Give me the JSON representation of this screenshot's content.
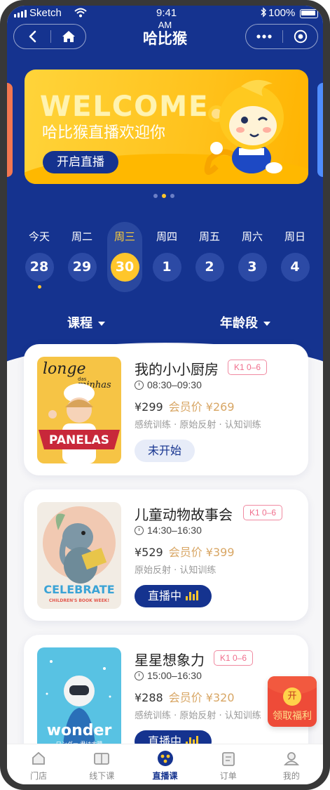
{
  "status_bar": {
    "carrier": "Sketch",
    "time": "9:41",
    "time_suffix": "AM",
    "battery": "100%"
  },
  "nav": {
    "title": "哈比猴",
    "back_icon": "chevron-left-icon",
    "home_icon": "home-icon",
    "more_icon": "more-dots-icon",
    "close_icon": "target-circle-icon"
  },
  "banner": {
    "headline": "WELCOME",
    "subtitle": "哈比猴直播欢迎你",
    "cta": "开启直播",
    "mascot": "monkey-mascot"
  },
  "carousel": {
    "total": 3,
    "active": 2
  },
  "week": [
    {
      "label": "今天",
      "date": "28",
      "selected": false,
      "has_event": true
    },
    {
      "label": "周二",
      "date": "29",
      "selected": false,
      "has_event": false
    },
    {
      "label": "周三",
      "date": "30",
      "selected": true,
      "has_event": false
    },
    {
      "label": "周四",
      "date": "1",
      "selected": false,
      "has_event": false
    },
    {
      "label": "周五",
      "date": "2",
      "selected": false,
      "has_event": false
    },
    {
      "label": "周六",
      "date": "3",
      "selected": false,
      "has_event": false
    },
    {
      "label": "周日",
      "date": "4",
      "selected": false,
      "has_event": false
    }
  ],
  "filters": {
    "course": "课程",
    "age": "年龄段"
  },
  "courses": [
    {
      "name": "我的小小厨房",
      "tag": "K1 0–6",
      "time": "08:30–09:30",
      "price": "¥299",
      "member_price": "会员价 ¥269",
      "skills": "感统训练 · 原始反射 · 认知训练",
      "button": "未开始",
      "live": false,
      "poster": {
        "text1": "longe",
        "text2": "das",
        "text3": "minhas",
        "text4": "PANELAS"
      }
    },
    {
      "name": "儿童动物故事会",
      "tag": "K1 0–6",
      "time": "14:30–16:30",
      "price": "¥529",
      "member_price": "会员价 ¥399",
      "skills": "原始反射 · 认知训练",
      "button": "直播中",
      "live": true,
      "poster": {
        "text1": "CELEBRATE",
        "text2": "CHILDREN'S BOOK WEEK!"
      }
    },
    {
      "name": "星星想象力",
      "tag": "K1 0–6",
      "time": "15:00–16:30",
      "price": "¥288",
      "member_price": "会员价 ¥320",
      "skills": "感统训练 · 原始反射 · 认知训练",
      "button": "直播中",
      "live": true,
      "poster": {
        "text1": "wonder",
        "text2": "ワンダー 君は太陽"
      }
    }
  ],
  "red_packet": {
    "coin": "开",
    "label": "领取福利"
  },
  "tabs": [
    {
      "label": "门店",
      "icon": "store-icon",
      "active": false
    },
    {
      "label": "线下课",
      "icon": "book-icon",
      "active": false
    },
    {
      "label": "直播课",
      "icon": "live-icon",
      "active": true
    },
    {
      "label": "订单",
      "icon": "order-icon",
      "active": false
    },
    {
      "label": "我的",
      "icon": "profile-icon",
      "active": false
    }
  ],
  "colors": {
    "primary": "#15338f",
    "accent": "#ffc62b",
    "member": "#d8a664",
    "tag": "#f06f8d"
  }
}
